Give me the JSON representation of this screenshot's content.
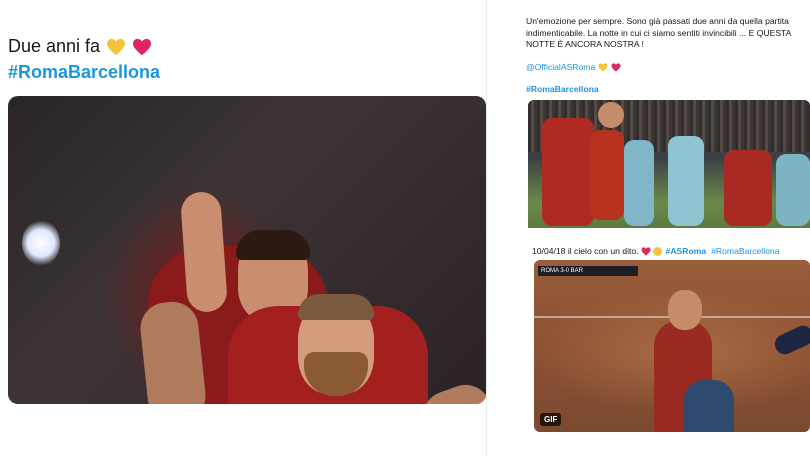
{
  "left_tweet": {
    "text": "Due anni fa",
    "emojis": [
      "yellow-heart",
      "red-heart"
    ],
    "hashtag": "#RomaBarcellona",
    "media": "photo-two-players-celebrating"
  },
  "right_top_tweet": {
    "text": "Un'emozione per sempre. Sono già passati due anni da quella partita indimenticabile. La notte in cui ci siamo sentiti invincibili ... E QUESTA NOTTE È ANCORA NOSTRA !",
    "mention": "@OfficialASRoma",
    "emojis": [
      "yellow-heart",
      "red-heart"
    ],
    "hashtag": "#RomaBarcellona",
    "media": "photo-match-action"
  },
  "right_bottom_tweet": {
    "text": "10/04/18 il cielo con un dito.",
    "emojis": [
      "red-heart",
      "heart-eyes-face"
    ],
    "hashtag1": "#ASRoma",
    "hashtag2": "#RomaBarcellona",
    "media": "gif-player-celebration",
    "gif_label": "GIF",
    "scoreboard": "ROMA 3-0 BAR"
  },
  "colors": {
    "link": "#1b95e0",
    "text": "#14171a",
    "yellow_heart": "#f5c33b",
    "red_heart": "#e0245e"
  }
}
